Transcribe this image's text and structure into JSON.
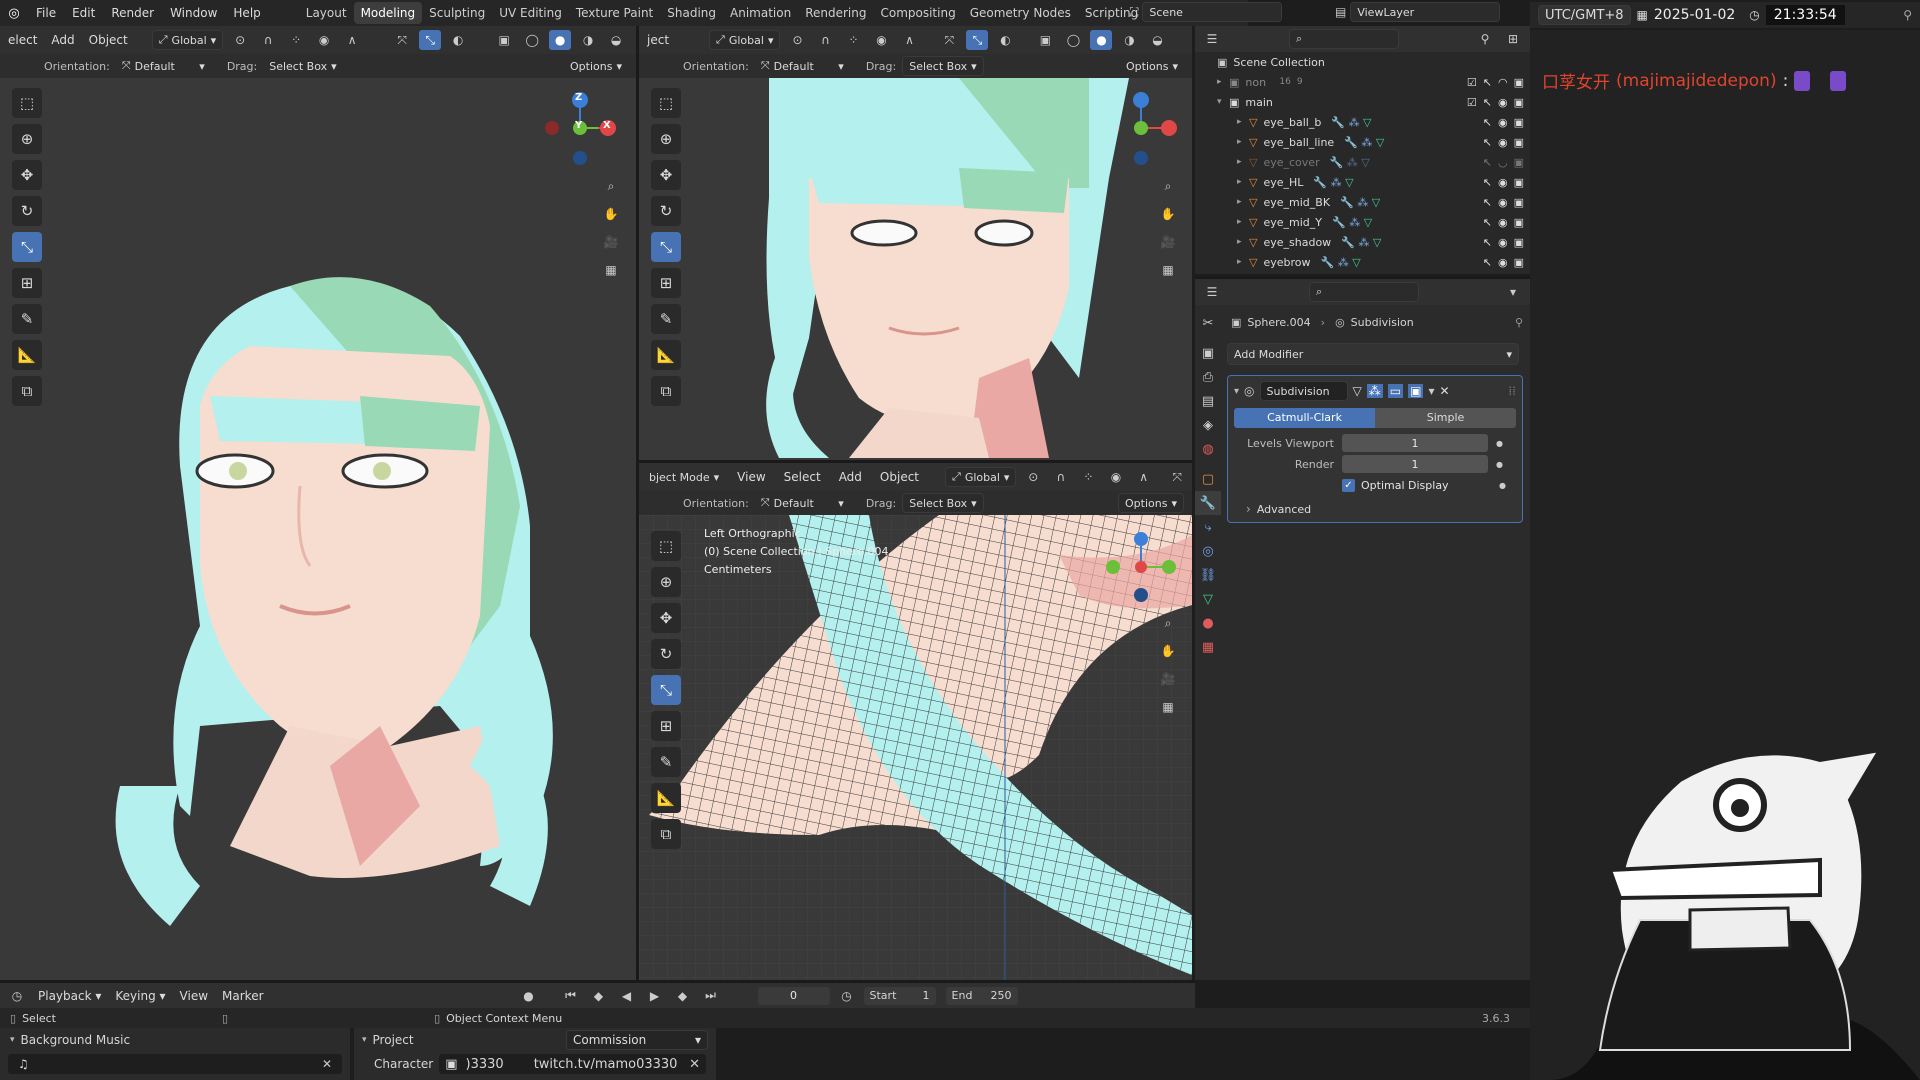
{
  "topbar": {
    "menus": [
      "File",
      "Edit",
      "Render",
      "Window",
      "Help"
    ],
    "workspaces": [
      "Layout",
      "Modeling",
      "Sculpting",
      "UV Editing",
      "Texture Paint",
      "Shading",
      "Animation",
      "Rendering",
      "Compositing",
      "Geometry Nodes",
      "Scripting"
    ],
    "active_workspace": "Modeling",
    "add_tab": "+",
    "scene_label": "Scene",
    "viewlayer_label": "ViewLayer"
  },
  "clock": {
    "timezone": "UTC/GMT+8",
    "date": "2025-01-02",
    "time": "21:33:54"
  },
  "chat": {
    "prefix": "口莩女开",
    "user": "(majimajidedepon)",
    "sep": ":"
  },
  "viewport_left": {
    "header_menus": [
      "elect",
      "Add",
      "Object"
    ],
    "transform": "Global",
    "orientation_label": "Orientation:",
    "orientation_value": "Default",
    "drag_label": "Drag:",
    "drag_value": "Select Box",
    "options": "Options"
  },
  "viewport_top_right": {
    "header_menus": [
      "ject"
    ],
    "transform": "Global",
    "orientation_label": "Orientation:",
    "orientation_value": "Default",
    "drag_label": "Drag:",
    "drag_value": "Select Box",
    "options": "Options"
  },
  "viewport_bottom": {
    "mode": "bject Mode",
    "header_menus": [
      "View",
      "Select",
      "Add",
      "Object"
    ],
    "transform": "Global",
    "orientation_label": "Orientation:",
    "orientation_value": "Default",
    "drag_label": "Drag:",
    "drag_value": "Select Box",
    "options": "Options",
    "overlay_view": "Left Orthographic",
    "overlay_collection": "(0) Scene Collection | Sphere.004",
    "overlay_units": "Centimeters"
  },
  "gizmo": {
    "z": "Z",
    "y": "Y",
    "x": "X"
  },
  "outliner": {
    "root": "Scene Collection",
    "collections": [
      {
        "name": "non",
        "badge1": "16",
        "badge2": "9"
      },
      {
        "name": "main"
      }
    ],
    "objects": [
      {
        "name": "eye_ball_b",
        "dimmed": false
      },
      {
        "name": "eye_ball_line",
        "dimmed": false
      },
      {
        "name": "eye_cover",
        "dimmed": true
      },
      {
        "name": "eye_HL",
        "dimmed": false
      },
      {
        "name": "eye_mid_BK",
        "dimmed": false
      },
      {
        "name": "eye_mid_Y",
        "dimmed": false
      },
      {
        "name": "eye_shadow",
        "dimmed": false
      },
      {
        "name": "eyebrow",
        "dimmed": false
      }
    ]
  },
  "properties": {
    "object": "Sphere.004",
    "modifier_crumb": "Subdivision",
    "add_modifier": "Add Modifier",
    "modifier_name": "Subdivision",
    "algo_a": "Catmull-Clark",
    "algo_b": "Simple",
    "levels_viewport_label": "Levels Viewport",
    "levels_viewport_value": "1",
    "render_label": "Render",
    "render_value": "1",
    "optimal_display": "Optimal Display",
    "advanced": "Advanced"
  },
  "timeline": {
    "menus": [
      "Playback",
      "Keying",
      "View",
      "Marker"
    ],
    "frame": "0",
    "start_label": "Start",
    "start_value": "1",
    "end_label": "End",
    "end_value": "250"
  },
  "statusbar": {
    "select": "Select",
    "context": "Object Context Menu",
    "version": "3.6.3"
  },
  "stream": {
    "bg_music": "Background Music",
    "project_label": "Project",
    "project_value": "Commission",
    "character_label": "Character",
    "character_value": ")3330",
    "link": "twitch.tv/mamo03330"
  },
  "colors": {
    "accent": "#4772b3",
    "hair": "#b3f0ee",
    "hair_dark": "#99d9b6",
    "skin": "#f7ddd0",
    "chat_name": "#e0442f"
  }
}
